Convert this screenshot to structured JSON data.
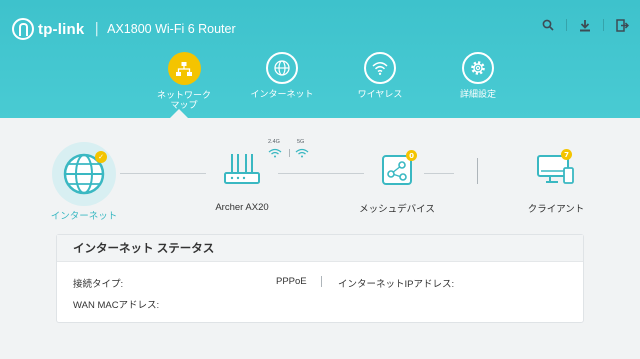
{
  "header": {
    "brand": "tp-link",
    "separator": "|",
    "model": "AX1800 Wi-Fi 6 Router",
    "icons": [
      "search-icon",
      "download-icon",
      "logout-icon"
    ]
  },
  "nav": {
    "tabs": [
      {
        "label": "ネットワーク\nマップ",
        "icon": "network-map-icon",
        "active": true
      },
      {
        "label": "インターネット",
        "icon": "globe-icon",
        "active": false
      },
      {
        "label": "ワイヤレス",
        "icon": "wifi-icon",
        "active": false
      },
      {
        "label": "詳細設定",
        "icon": "gear-icon",
        "active": false
      }
    ]
  },
  "topology": {
    "internet": {
      "label": "インターネット",
      "status": "connected"
    },
    "router": {
      "label": "Archer AX20",
      "band_24": "2.4G",
      "band_5": "5G"
    },
    "mesh": {
      "label": "メッシュデバイス",
      "count": "0"
    },
    "clients": {
      "label": "クライアント",
      "count": "7"
    }
  },
  "status_card": {
    "title": "インターネット ステータス",
    "connection_type_label": "接続タイプ:",
    "connection_type_value": "PPPoE",
    "ip_label": "インターネットIPアドレス:",
    "ip_value": "",
    "mac_label": "WAN MACアドレス:",
    "mac_value": ""
  },
  "colors": {
    "header_bg": "#45c7d0",
    "accent_yellow": "#f4c400",
    "teal": "#3ab8c2"
  }
}
